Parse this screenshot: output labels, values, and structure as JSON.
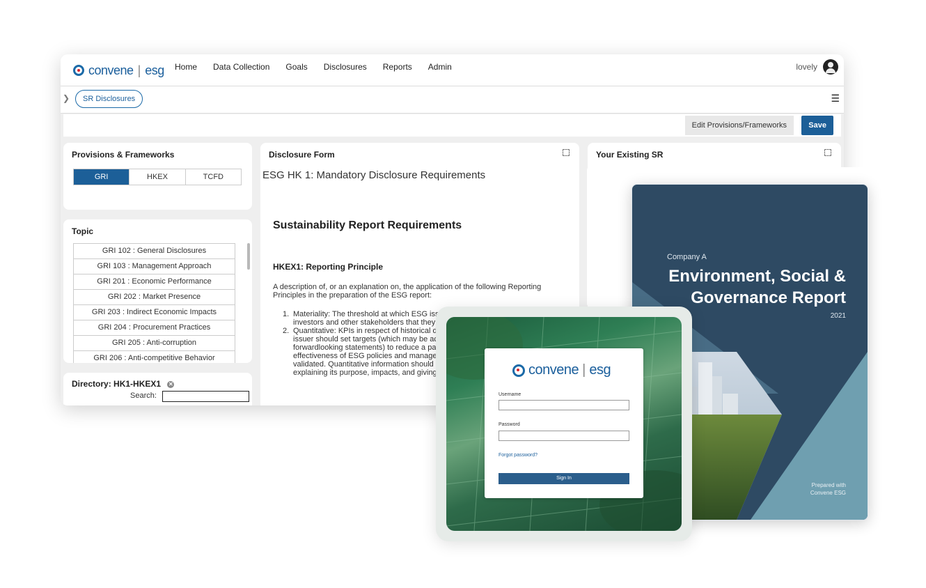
{
  "app": {
    "logo": {
      "brand": "convene",
      "product": "esg"
    },
    "nav": [
      "Home",
      "Data Collection",
      "Goals",
      "Disclosures",
      "Reports",
      "Admin"
    ],
    "user": {
      "name": "lovely"
    },
    "breadcrumb": {
      "label": "SR Disclosures"
    },
    "actions": {
      "edit_label": "Edit Provisions/Frameworks",
      "save_label": "Save"
    },
    "provisions": {
      "title": "Provisions & Frameworks",
      "tabs": [
        "GRI",
        "HKEX",
        "TCFD"
      ],
      "active_tab": "GRI"
    },
    "topic": {
      "title": "Topic",
      "items": [
        "GRI 102 : General Disclosures",
        "GRI 103 : Management Approach",
        "GRI 201 : Economic Performance",
        "GRI 202 : Market Presence",
        "GRI 203 : Indirect Economic Impacts",
        "GRI 204 : Procurement Practices",
        "GRI 205 : Anti-corruption",
        "GRI 206 : Anti-competitive Behavior"
      ]
    },
    "directory": {
      "label": "Directory:",
      "value": "HK1-HKEX1",
      "search_label": "Search:"
    },
    "disclosure_form": {
      "title": "Disclosure Form",
      "subtitle": "ESG HK 1: Mandatory Disclosure Requirements",
      "heading": "Sustainability Report Requirements",
      "subheading": "HKEX1: Reporting Principle",
      "intro": "A description of, or an explanation on, the application of the following Reporting Principles in the preparation of the ESG report:",
      "list": [
        "Materiality: The threshold at which ESG issues become sufficiently important to investors and other stakeholders that they should be reported.",
        "Quantitative: KPIs in respect of historical data need to be measurable. The issuer should set targets (which may be actual numerical figures or directional, forwardlooking statements) to reduce a particular impact. In this way the effectiveness of ESG policies and management systems can be evaluated and validated. Quantitative information should be accompanied by a narrative, explaining its purpose, impacts, and giving comparative data where appropriate."
      ]
    },
    "existing_sr": {
      "title": "Your Existing SR"
    }
  },
  "report_cover": {
    "company": "Company A",
    "title_line1": "Environment, Social &",
    "title_line2": "Governance Report",
    "year": "2021",
    "prepared_line1": "Prepared with",
    "prepared_line2": "Convene ESG",
    "colors": {
      "navy": "#2e4a63",
      "teal": "#6f9fb0"
    }
  },
  "login": {
    "logo": {
      "brand": "convene",
      "product": "esg"
    },
    "username_label": "Username",
    "password_label": "Password",
    "forgot_label": "Forgot password?",
    "signin_label": "Sign In"
  }
}
